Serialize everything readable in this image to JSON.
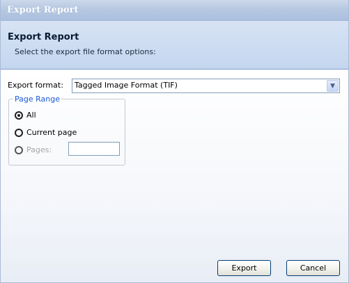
{
  "window": {
    "title": "Export Report"
  },
  "header": {
    "title": "Export Report",
    "subtitle": "Select the export file format options:"
  },
  "format": {
    "label": "Export format:",
    "selected": "Tagged Image Format (TIF)",
    "arrow_icon": "chevron-down-icon"
  },
  "page_range": {
    "legend": "Page Range",
    "options": [
      {
        "label": "All",
        "checked": true,
        "enabled": true
      },
      {
        "label": "Current page",
        "checked": false,
        "enabled": true
      },
      {
        "label": "Pages:",
        "checked": false,
        "enabled": false
      }
    ],
    "pages_value": ""
  },
  "buttons": {
    "export": "Export",
    "cancel": "Cancel"
  },
  "colors": {
    "legend": "#1c5ad8",
    "header_bg": "#c4d6ef",
    "titlebar_bg": "#b7c8e2"
  }
}
